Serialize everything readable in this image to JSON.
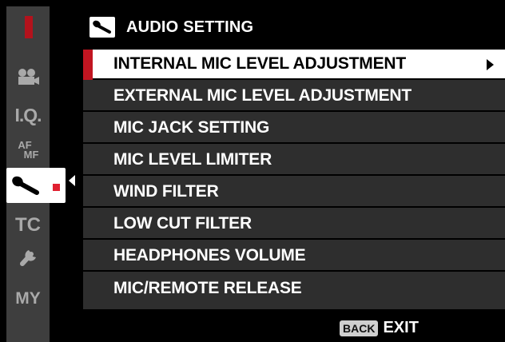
{
  "header": {
    "title": "AUDIO SETTING",
    "icon": "microphone-icon"
  },
  "tabs": [
    {
      "id": "movie",
      "icon": "movie-camera-icon",
      "label": ""
    },
    {
      "id": "iq",
      "label": "I.Q."
    },
    {
      "id": "afmf",
      "label_top": "AF",
      "label_bottom": "MF"
    },
    {
      "id": "audio",
      "icon": "microphone-icon",
      "active": true
    },
    {
      "id": "tc",
      "label": "TC"
    },
    {
      "id": "setup",
      "icon": "wrench-icon"
    },
    {
      "id": "my",
      "label": "MY"
    }
  ],
  "menu": {
    "items": [
      {
        "label": "INTERNAL MIC LEVEL ADJUSTMENT",
        "selected": true,
        "has_submenu": true
      },
      {
        "label": "EXTERNAL MIC LEVEL ADJUSTMENT"
      },
      {
        "label": "MIC JACK SETTING"
      },
      {
        "label": "MIC LEVEL LIMITER"
      },
      {
        "label": "WIND FILTER"
      },
      {
        "label": "LOW CUT FILTER"
      },
      {
        "label": "HEADPHONES VOLUME"
      },
      {
        "label": "MIC/REMOTE RELEASE"
      }
    ]
  },
  "footer": {
    "back_key": "BACK",
    "exit_label": "EXIT"
  },
  "colors": {
    "accent_red": "#c11521",
    "tab_bg": "#3e3e3e",
    "row_bg": "#2e2e2e"
  }
}
